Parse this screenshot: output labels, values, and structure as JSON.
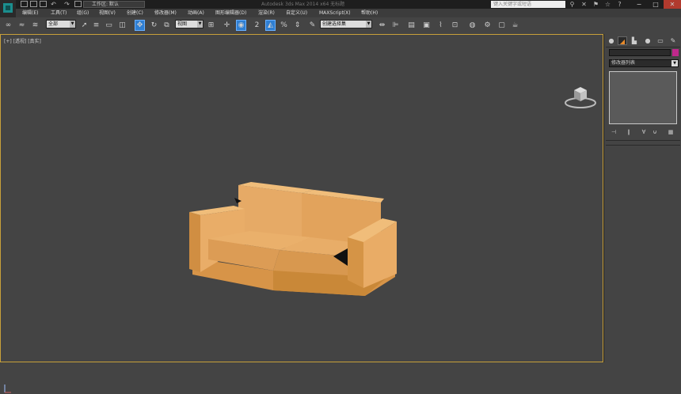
{
  "titlebar": {
    "workspace_label": "工作区: 默认",
    "window_title": "Autodesk 3ds Max 2014 x64  无标题",
    "search_placeholder": "键入关键字或短语"
  },
  "menu": {
    "items": [
      "编辑(E)",
      "工具(T)",
      "组(G)",
      "视图(V)",
      "创建(C)",
      "修改器(M)",
      "动画(A)",
      "图形编辑器(D)",
      "渲染(R)",
      "自定义(U)",
      "MAXScript(X)",
      "帮助(H)"
    ]
  },
  "toolbar": {
    "selection_filter": "全部",
    "ref_coord": "视图",
    "named_selection": "创建选择集"
  },
  "viewport": {
    "label": "[+] [透视] [真实]"
  },
  "cmdpanel": {
    "modifier_list": "修改器列表"
  },
  "colors": {
    "accent": "#2f7fd3",
    "viewport_border": "#c8a03a",
    "object_color": "#c0288c",
    "sofa": "#e2a560"
  }
}
